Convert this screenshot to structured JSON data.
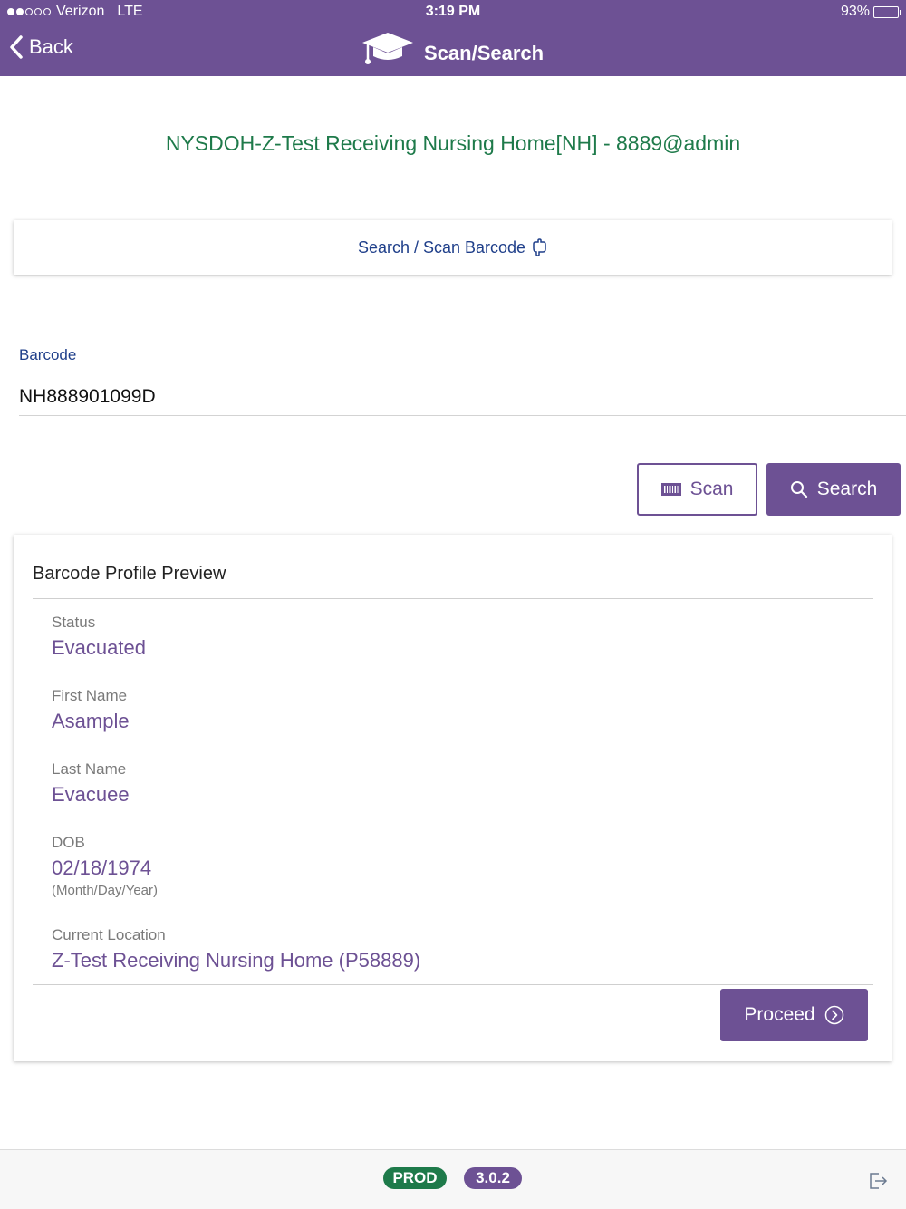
{
  "status_bar": {
    "carrier": "Verizon",
    "network": "LTE",
    "time": "3:19 PM",
    "battery": "93%",
    "battery_level": 0.93,
    "signal_bars_filled": 2,
    "signal_bars_total": 5
  },
  "nav": {
    "back_label": "Back",
    "title": "Scan/Search",
    "title_icon": "graduation-cap-icon"
  },
  "facility_title": "NYSDOH-Z-Test Receiving Nursing Home[NH] - 8889@admin",
  "scan_bar": {
    "label": "Search / Scan Barcode",
    "icon": "hand-pointer-icon"
  },
  "barcode": {
    "label": "Barcode",
    "value": "NH888901099D"
  },
  "actions": {
    "scan_label": "Scan",
    "scan_icon": "barcode-icon",
    "search_label": "Search",
    "search_icon": "search-icon"
  },
  "profile": {
    "title": "Barcode Profile Preview",
    "fields": [
      {
        "label": "Status",
        "value": "Evacuated"
      },
      {
        "label": "First Name",
        "value": "Asample"
      },
      {
        "label": "Last Name",
        "value": "Evacuee"
      },
      {
        "label": "DOB",
        "value": "02/18/1974",
        "hint": "(Month/Day/Year)"
      },
      {
        "label": "Current Location",
        "value": "Z-Test Receiving Nursing Home (P58889)"
      }
    ],
    "proceed_label": "Proceed",
    "proceed_icon": "chevron-circle-right-icon"
  },
  "footer": {
    "env_badge": "PROD",
    "version_badge": "3.0.2",
    "logout_icon": "sign-out-icon"
  },
  "colors": {
    "primary": "#6d5194",
    "green": "#1e7a4a",
    "link_blue": "#1f3f8a"
  }
}
